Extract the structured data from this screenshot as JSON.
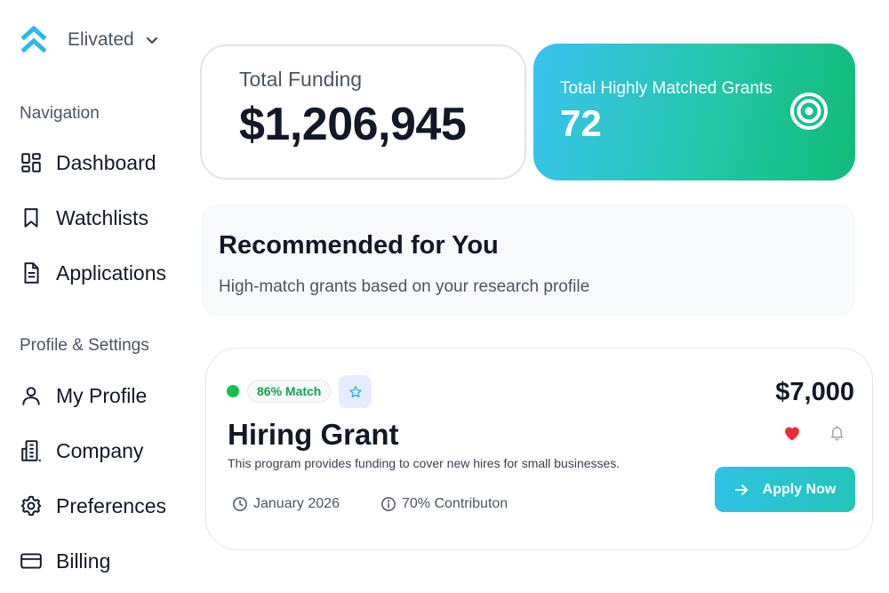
{
  "brand": {
    "name": "Elivated",
    "accent": "#2bb8ee"
  },
  "sidebar": {
    "navigation_heading": "Navigation",
    "nav_items": [
      {
        "label": "Dashboard",
        "icon": "dashboard-icon"
      },
      {
        "label": "Watchlists",
        "icon": "bookmark-icon"
      },
      {
        "label": "Applications",
        "icon": "document-icon"
      }
    ],
    "settings_heading": "Profile & Settings",
    "settings_items": [
      {
        "label": "My Profile",
        "icon": "user-icon"
      },
      {
        "label": "Company",
        "icon": "building-icon"
      },
      {
        "label": "Preferences",
        "icon": "gear-icon"
      },
      {
        "label": "Billing",
        "icon": "credit-card-icon"
      }
    ]
  },
  "stats": {
    "total_funding": {
      "label": "Total Funding",
      "value": "$1,206,945"
    },
    "matched_grants": {
      "label": "Total Highly Matched Grants",
      "value": "72",
      "icon": "target-icon"
    }
  },
  "recommended": {
    "title": "Recommended for You",
    "subtitle": "High-match grants based on your research profile"
  },
  "grant": {
    "match": "86% Match",
    "amount": "$7,000",
    "title": "Hiring Grant",
    "description": "This program provides funding to cover new hires for small businesses.",
    "date": "January 2026",
    "contribution": "70% Contributon",
    "apply_label": "Apply Now",
    "favorited": true
  },
  "colors": {
    "match_green": "#13c14d",
    "heart_red": "#ef2b3a",
    "gradient_start": "#39c3f0",
    "gradient_end": "#12bb78"
  }
}
